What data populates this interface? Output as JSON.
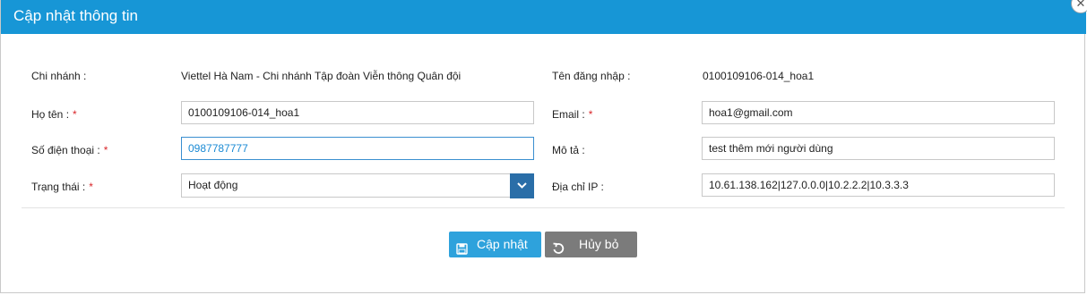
{
  "dialog": {
    "title": "Cập nhật thông tin",
    "close_icon": "close-icon"
  },
  "form": {
    "branch": {
      "label": "Chi nhánh :",
      "value": "Viettel Hà Nam - Chi nhánh Tập đoàn Viễn thông Quân đội"
    },
    "username": {
      "label": "Tên đăng nhập :",
      "value": "0100109106-014_hoa1"
    },
    "full_name": {
      "label": "Họ tên :",
      "required": "*",
      "value": "0100109106-014_hoa1"
    },
    "email": {
      "label": "Email :",
      "required": "*",
      "value": "hoa1@gmail.com"
    },
    "phone": {
      "label": "Số điện thoại :",
      "required": "*",
      "value": "0987787777"
    },
    "description": {
      "label": "Mô tả :",
      "value": "test thêm mới người dùng"
    },
    "status": {
      "label": "Trạng thái :",
      "required": "*",
      "value": "Hoạt động"
    },
    "ip_address": {
      "label": "Địa chỉ IP :",
      "value": "10.61.138.162|127.0.0.0|10.2.2.2|10.3.3.3"
    }
  },
  "actions": {
    "update_label": "Cập nhật",
    "cancel_label": "Hủy bỏ",
    "update_icon": "save-icon",
    "cancel_icon": "undo-icon"
  },
  "colors": {
    "header": "#1796d6",
    "primary_button": "#2ea2dc",
    "secondary_button": "#7b7b7b",
    "required": "#d9262a",
    "select_arrow": "#2a6ea8"
  }
}
